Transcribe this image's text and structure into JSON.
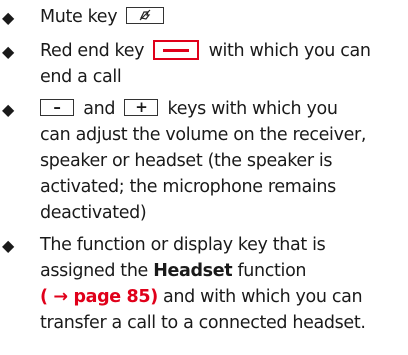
{
  "items": [
    {
      "bullet": "◆",
      "before": "Mute key",
      "key_label": ""
    },
    {
      "bullet": "◆",
      "before": "Red end key",
      "after": "with which you can",
      "line2": "end a call"
    },
    {
      "bullet": "◆",
      "key1": "–",
      "mid": "and",
      "key2": "+",
      "after": "keys with which you",
      "line2": "can adjust the volume on the receiver,",
      "line3": "speaker or headset (the speaker is",
      "line4": "activated; the microphone remains",
      "line5": "deactivated)"
    },
    {
      "bullet": "◆",
      "line1": "The function or display key that is",
      "line2_before": "assigned the",
      "line2_bold": "Headset",
      "line2_after": "function",
      "ref_open": "( ",
      "ref_arrow": "→",
      "ref_text": " page 85)",
      "line3_after": " and with which you can",
      "line4": "transfer a call to a connected headset."
    }
  ]
}
